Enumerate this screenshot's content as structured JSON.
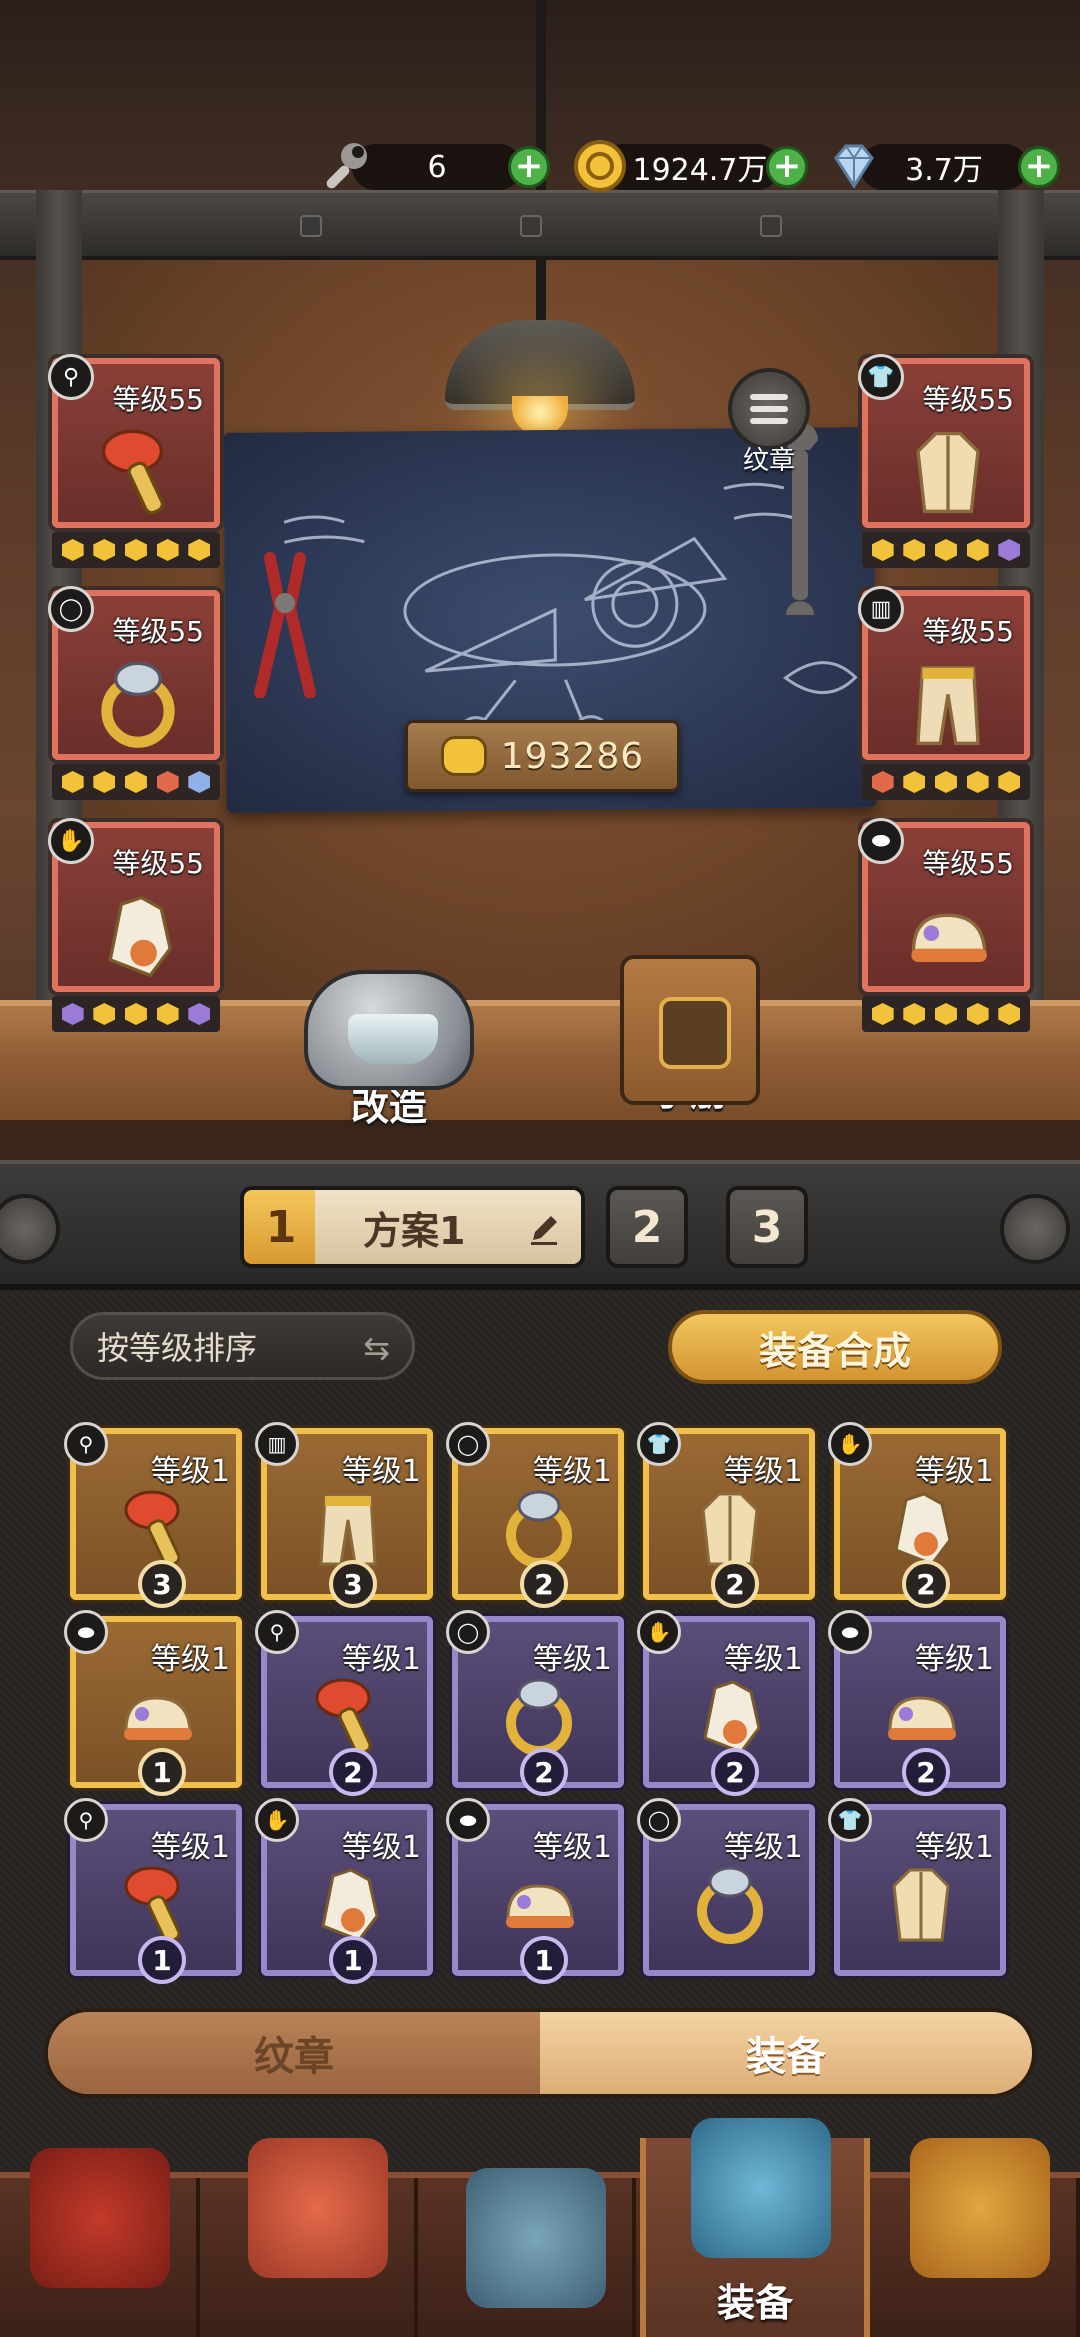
{
  "resources": [
    {
      "name": "wrench",
      "value": "6",
      "icon": "wrench-icon"
    },
    {
      "name": "gold",
      "value": "1924.7万",
      "icon": "coin-icon"
    },
    {
      "name": "diamond",
      "value": "3.7万",
      "icon": "diamond-icon"
    }
  ],
  "badge_button_label": "纹章",
  "power_value": "193286",
  "equipped_left": [
    {
      "level": "等级55",
      "type": "key",
      "gems": [
        "#f2c23a",
        "#f2c23a",
        "#f2c23a",
        "#f2c23a",
        "#f2c23a"
      ]
    },
    {
      "level": "等级55",
      "type": "ring",
      "gems": [
        "#f2c23a",
        "#f2c23a",
        "#f2c23a",
        "#e06a4a",
        "#8fb0e8"
      ]
    },
    {
      "level": "等级55",
      "type": "glove",
      "gems": [
        "#9b7ad8",
        "#f2c23a",
        "#f2c23a",
        "#f2c23a",
        "#9b7ad8"
      ]
    }
  ],
  "equipped_right": [
    {
      "level": "等级55",
      "type": "jacket",
      "gems": [
        "#f2c23a",
        "#f2c23a",
        "#f2c23a",
        "#f2c23a",
        "#9b7ad8"
      ]
    },
    {
      "level": "等级55",
      "type": "pants",
      "gems": [
        "#e06a4a",
        "#f2c23a",
        "#f2c23a",
        "#f2c23a",
        "#f2c23a"
      ]
    },
    {
      "level": "等级55",
      "type": "shoes",
      "gems": [
        "#f2c23a",
        "#f2c23a",
        "#f2c23a",
        "#f2c23a",
        "#f2c23a"
      ]
    }
  ],
  "remodel_label": "改造",
  "manual_label": "手册",
  "plan": {
    "active_number": "1",
    "active_name": "方案1",
    "other_numbers": [
      "2",
      "3"
    ]
  },
  "sort_label": "按等级排序",
  "synthesize_label": "装备合成",
  "inventory": [
    {
      "level": "等级1",
      "type": "key",
      "rarity": "gold",
      "count": "3"
    },
    {
      "level": "等级1",
      "type": "pants",
      "rarity": "gold",
      "count": "3"
    },
    {
      "level": "等级1",
      "type": "ring",
      "rarity": "gold",
      "count": "2"
    },
    {
      "level": "等级1",
      "type": "jacket",
      "rarity": "gold",
      "count": "2"
    },
    {
      "level": "等级1",
      "type": "glove",
      "rarity": "gold",
      "count": "2"
    },
    {
      "level": "等级1",
      "type": "shoes",
      "rarity": "gold",
      "count": "1"
    },
    {
      "level": "等级1",
      "type": "key",
      "rarity": "purple",
      "count": "2"
    },
    {
      "level": "等级1",
      "type": "ring",
      "rarity": "purple",
      "count": "2"
    },
    {
      "level": "等级1",
      "type": "glove",
      "rarity": "purple",
      "count": "2"
    },
    {
      "level": "等级1",
      "type": "shoes",
      "rarity": "purple",
      "count": "2"
    },
    {
      "level": "等级1",
      "type": "key",
      "rarity": "purple",
      "count": "1"
    },
    {
      "level": "等级1",
      "type": "glove",
      "rarity": "purple",
      "count": "1"
    },
    {
      "level": "等级1",
      "type": "shoes",
      "rarity": "purple",
      "count": "1"
    },
    {
      "level": "等级1",
      "type": "ring",
      "rarity": "purple",
      "count": ""
    },
    {
      "level": "等级1",
      "type": "jacket",
      "rarity": "purple",
      "count": ""
    }
  ],
  "segments": {
    "left": "纹章",
    "right": "装备",
    "selected": "right"
  },
  "nav": {
    "active_label": "装备",
    "active_index": 3
  }
}
